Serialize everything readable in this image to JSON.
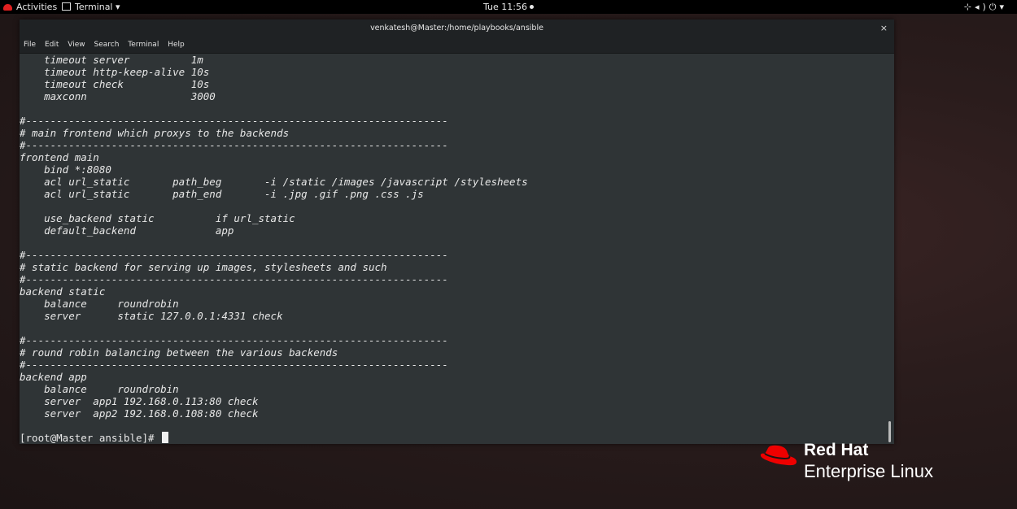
{
  "topbar": {
    "activities": "Activities",
    "app_menu": "Terminal ▾",
    "clock": "Tue 11:56",
    "system_icons": [
      "network-icon",
      "volume-icon",
      "power-icon",
      "clipboard-icon"
    ]
  },
  "window": {
    "title": "venkatesh@Master:/home/playbooks/ansible",
    "close_label": "×",
    "menu": [
      "File",
      "Edit",
      "View",
      "Search",
      "Terminal",
      "Help"
    ]
  },
  "terminal": {
    "lines": [
      "    timeout server          1m",
      "    timeout http-keep-alive 10s",
      "    timeout check           10s",
      "    maxconn                 3000",
      "",
      "#---------------------------------------------------------------------",
      "# main frontend which proxys to the backends",
      "#---------------------------------------------------------------------",
      "frontend main",
      "    bind *:8080",
      "    acl url_static       path_beg       -i /static /images /javascript /stylesheets",
      "    acl url_static       path_end       -i .jpg .gif .png .css .js",
      "",
      "    use_backend static          if url_static",
      "    default_backend             app",
      "",
      "#---------------------------------------------------------------------",
      "# static backend for serving up images, stylesheets and such",
      "#---------------------------------------------------------------------",
      "backend static",
      "    balance     roundrobin",
      "    server      static 127.0.0.1:4331 check",
      "",
      "#---------------------------------------------------------------------",
      "# round robin balancing between the various backends",
      "#---------------------------------------------------------------------",
      "backend app",
      "    balance     roundrobin",
      "    server  app1 192.168.0.113:80 check",
      "    server  app2 192.168.0.108:80 check",
      ""
    ],
    "prompt": "[root@Master ansible]# "
  },
  "branding": {
    "line1": "Red Hat",
    "line2": "Enterprise Linux"
  }
}
